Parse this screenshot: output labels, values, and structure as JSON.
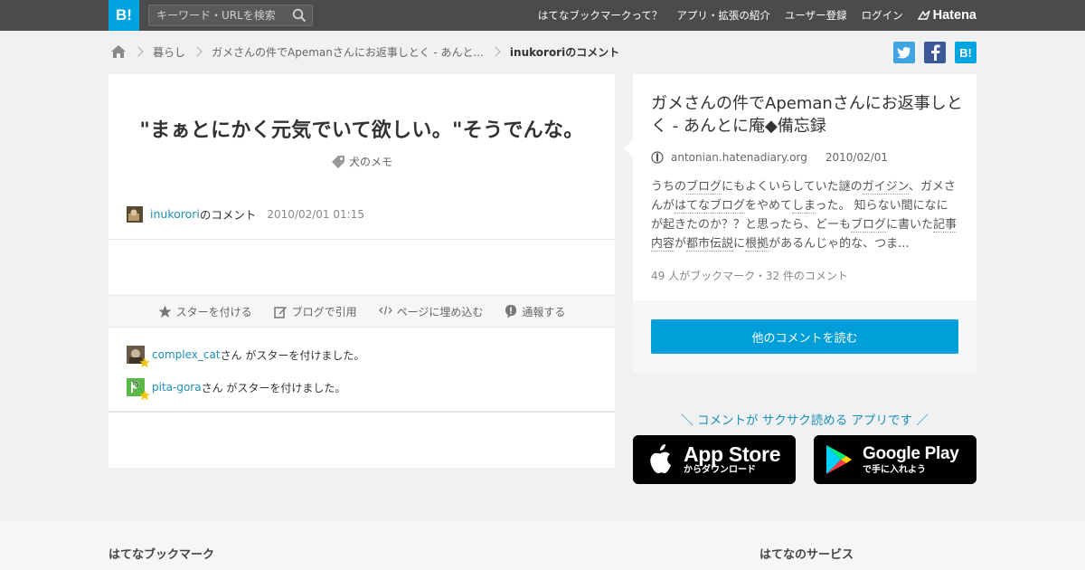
{
  "header": {
    "logo": "B!",
    "search_placeholder": "キーワード・URLを検索",
    "nav": [
      "はてなブックマークって？",
      "アプリ・拡張の紹介",
      "ユーザー登録",
      "ログイン"
    ],
    "brand": "Hatena",
    "brand_color": "#00a4de",
    "bar_color": "#4b4b4b"
  },
  "breadcrumb": {
    "category": "暮らし",
    "entry": "ガメさんの件でApemanさんにお返事しとく - あんと...",
    "current": "inukororiのコメント"
  },
  "share": {
    "twitter": "twitter-icon",
    "facebook": "facebook-icon",
    "hatena": "B!"
  },
  "comment": {
    "text": "\"まぁとにかく元気でいて欲しい。\"そうでんな。",
    "tag": "犬のメモ",
    "user": "inukorori",
    "user_suffix": "のコメント",
    "date": "2010/02/01 01:15"
  },
  "actions": [
    "スターを付ける",
    "ブログで引用",
    "ページに埋め込む",
    "通報する"
  ],
  "stars": [
    {
      "user": "complex_cat",
      "text": "さん がスターを付けました。"
    },
    {
      "user": "pita-gora",
      "text": "さん がスターを付けました。"
    }
  ],
  "entry": {
    "title": "ガメさんの件でApemanさんにお返事しとく - あんとに庵◆備忘録",
    "domain": "antonian.hatenadiary.org",
    "date": "2010/02/01",
    "summary": [
      {
        "t": "うちの"
      },
      {
        "t": "ブログ",
        "kw": true
      },
      {
        "t": "にもよくいらしていた謎の"
      },
      {
        "t": "ガイジン",
        "kw": true
      },
      {
        "t": "、ガメさんが"
      },
      {
        "t": "はてなブログ",
        "kw": true
      },
      {
        "t": "をやめて"
      },
      {
        "t": "しま",
        "kw": true
      },
      {
        "t": "った。 知らない間になにが起きたのか？？と思ったら、どーも"
      },
      {
        "t": "ブログ",
        "kw": true
      },
      {
        "t": "に書いた"
      },
      {
        "t": "記事内容",
        "kw": true
      },
      {
        "t": "が"
      },
      {
        "t": "都市伝説",
        "kw": true
      },
      {
        "t": "に"
      },
      {
        "t": "根拠",
        "kw": true
      },
      {
        "t": "があるんじゃ的な、つま..."
      }
    ],
    "stats": "49 人がブックマーク・32 件のコメント",
    "read_more": "他のコメントを読む"
  },
  "app": {
    "promo": "＼ コメントが サクサク読める アプリです ／",
    "appstore_big": "App Store",
    "appstore_small": "からダウンロード",
    "googleplay_big": "Google Play",
    "googleplay_small": "で手に入れよう"
  },
  "footer": {
    "left_heading": "はてなブックマーク",
    "right_heading": "はてなのサービス"
  },
  "colors": {
    "link": "#1f8fb8",
    "button": "#009fd9",
    "star": "#f5c400"
  }
}
